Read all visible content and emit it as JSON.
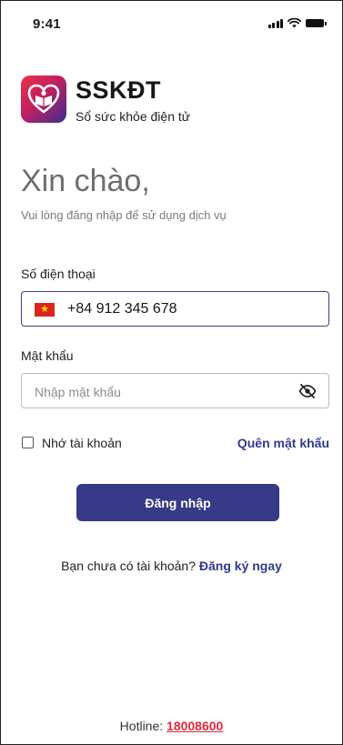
{
  "status_bar": {
    "time": "9:41",
    "icons": [
      "signal-icon",
      "wifi-icon",
      "battery-icon"
    ]
  },
  "brand": {
    "title": "SSKĐT",
    "subtitle": "Sổ sức khỏe điện tử",
    "logo_icon": "heart-book-icon",
    "gradient": [
      "#e8334a",
      "#c21f5f",
      "#3b2f8f"
    ]
  },
  "greeting": {
    "title": "Xin chào,",
    "subtitle": "Vui lòng đăng nhập để sử dụng dịch vụ"
  },
  "phone": {
    "label": "Số điện thoại",
    "value": "+84 912 345 678",
    "flag_icon": "vietnam-flag-icon"
  },
  "password": {
    "label": "Mật khẩu",
    "placeholder": "Nhập mật khẩu",
    "toggle_icon": "eye-off-icon"
  },
  "options": {
    "remember_label": "Nhớ tài khoản",
    "remember_checked": false,
    "forgot_label": "Quên mật khẩu"
  },
  "login_button": {
    "label": "Đăng nhập"
  },
  "signup": {
    "prompt": "Bạn chưa có tài khoản?",
    "link": "Đăng ký ngay"
  },
  "footer": {
    "hotline_label": "Hotline:",
    "hotline_number": "18008600"
  },
  "colors": {
    "primary": "#363a87",
    "link": "#2f3a8c",
    "hotline": "#e0283c"
  }
}
